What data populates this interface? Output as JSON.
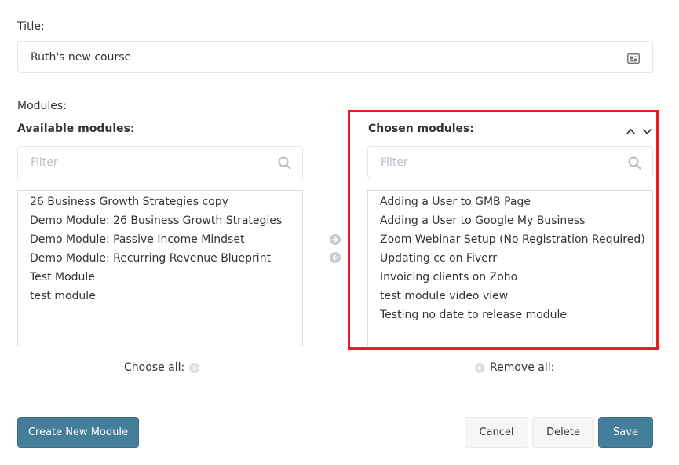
{
  "title_field": {
    "label": "Title:",
    "value": "Ruth's new course"
  },
  "modules": {
    "label": "Modules:",
    "available": {
      "heading": "Available modules:",
      "filter_placeholder": "Filter",
      "items": [
        "26 Business Growth Strategies copy",
        "Demo Module: 26 Business Growth Strategies",
        "Demo Module: Passive Income Mindset",
        "Demo Module: Recurring Revenue Blueprint",
        "Test Module",
        "test module"
      ],
      "choose_all_label": "Choose all:"
    },
    "chosen": {
      "heading": "Chosen modules:",
      "filter_placeholder": "Filter",
      "items": [
        "Adding a User to GMB Page",
        "Adding a User to Google My Business",
        "Zoom Webinar Setup (No Registration Required)",
        "Updating cc on Fiverr",
        "Invoicing clients on Zoho",
        "test module video view",
        "Testing no date to release module"
      ],
      "remove_all_label": "Remove all:"
    }
  },
  "buttons": {
    "create_module": "Create New Module",
    "cancel": "Cancel",
    "delete": "Delete",
    "save": "Save"
  },
  "colors": {
    "primary": "#447e9b",
    "highlight": "#ee1b24",
    "icon_gray": "#c8ccd1"
  }
}
